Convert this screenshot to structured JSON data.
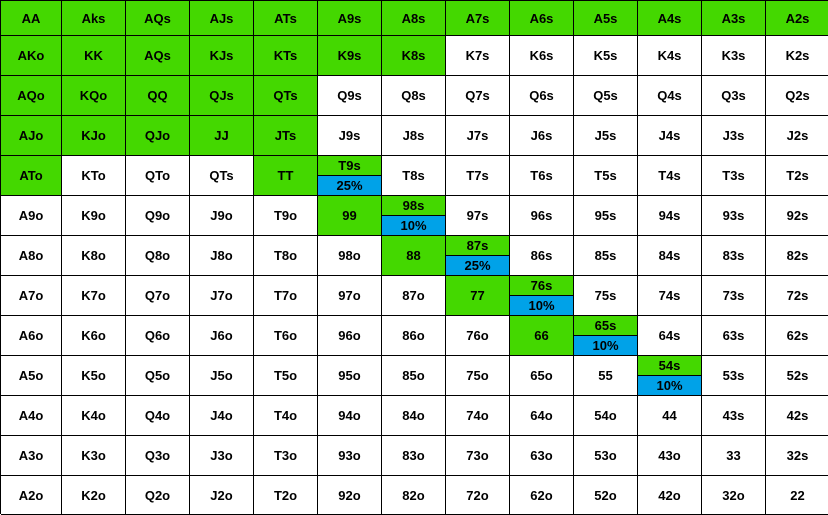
{
  "colors": {
    "raise": "#44d800",
    "mixed": "#00a2e8",
    "fold": "#ffffff"
  },
  "rows": [
    [
      {
        "h": "AA",
        "a": "full"
      },
      {
        "h": "Aks",
        "a": "full"
      },
      {
        "h": "AQs",
        "a": "full"
      },
      {
        "h": "AJs",
        "a": "full"
      },
      {
        "h": "ATs",
        "a": "full"
      },
      {
        "h": "A9s",
        "a": "full"
      },
      {
        "h": "A8s",
        "a": "full"
      },
      {
        "h": "A7s",
        "a": "full"
      },
      {
        "h": "A6s",
        "a": "full"
      },
      {
        "h": "A5s",
        "a": "full"
      },
      {
        "h": "A4s",
        "a": "full"
      },
      {
        "h": "A3s",
        "a": "full"
      },
      {
        "h": "A2s",
        "a": "full"
      }
    ],
    [
      {
        "h": "AKo",
        "a": "full"
      },
      {
        "h": "KK",
        "a": "full"
      },
      {
        "h": "AQs",
        "a": "full"
      },
      {
        "h": "KJs",
        "a": "full"
      },
      {
        "h": "KTs",
        "a": "full"
      },
      {
        "h": "K9s",
        "a": "full"
      },
      {
        "h": "K8s",
        "a": "full"
      },
      {
        "h": "K7s",
        "a": "none"
      },
      {
        "h": "K6s",
        "a": "none"
      },
      {
        "h": "K5s",
        "a": "none"
      },
      {
        "h": "K4s",
        "a": "none"
      },
      {
        "h": "K3s",
        "a": "none"
      },
      {
        "h": "K2s",
        "a": "none"
      }
    ],
    [
      {
        "h": "AQo",
        "a": "full"
      },
      {
        "h": "KQo",
        "a": "full"
      },
      {
        "h": "QQ",
        "a": "full"
      },
      {
        "h": "QJs",
        "a": "full"
      },
      {
        "h": "QTs",
        "a": "full"
      },
      {
        "h": "Q9s",
        "a": "none"
      },
      {
        "h": "Q8s",
        "a": "none"
      },
      {
        "h": "Q7s",
        "a": "none"
      },
      {
        "h": "Q6s",
        "a": "none"
      },
      {
        "h": "Q5s",
        "a": "none"
      },
      {
        "h": "Q4s",
        "a": "none"
      },
      {
        "h": "Q3s",
        "a": "none"
      },
      {
        "h": "Q2s",
        "a": "none"
      }
    ],
    [
      {
        "h": "AJo",
        "a": "full"
      },
      {
        "h": "KJo",
        "a": "full"
      },
      {
        "h": "QJo",
        "a": "full"
      },
      {
        "h": "JJ",
        "a": "full"
      },
      {
        "h": "JTs",
        "a": "full"
      },
      {
        "h": "J9s",
        "a": "none"
      },
      {
        "h": "J8s",
        "a": "none"
      },
      {
        "h": "J7s",
        "a": "none"
      },
      {
        "h": "J6s",
        "a": "none"
      },
      {
        "h": "J5s",
        "a": "none"
      },
      {
        "h": "J4s",
        "a": "none"
      },
      {
        "h": "J3s",
        "a": "none"
      },
      {
        "h": "J2s",
        "a": "none"
      }
    ],
    [
      {
        "h": "ATo",
        "a": "full"
      },
      {
        "h": "KTo",
        "a": "none"
      },
      {
        "h": "QTo",
        "a": "none"
      },
      {
        "h": "QTs",
        "a": "none"
      },
      {
        "h": "TT",
        "a": "full"
      },
      {
        "h": "T9s",
        "a": "split",
        "p": "25%"
      },
      {
        "h": "T8s",
        "a": "none"
      },
      {
        "h": "T7s",
        "a": "none"
      },
      {
        "h": "T6s",
        "a": "none"
      },
      {
        "h": "T5s",
        "a": "none"
      },
      {
        "h": "T4s",
        "a": "none"
      },
      {
        "h": "T3s",
        "a": "none"
      },
      {
        "h": "T2s",
        "a": "none"
      }
    ],
    [
      {
        "h": "A9o",
        "a": "none"
      },
      {
        "h": "K9o",
        "a": "none"
      },
      {
        "h": "Q9o",
        "a": "none"
      },
      {
        "h": "J9o",
        "a": "none"
      },
      {
        "h": "T9o",
        "a": "none"
      },
      {
        "h": "99",
        "a": "full"
      },
      {
        "h": "98s",
        "a": "split",
        "p": "10%"
      },
      {
        "h": "97s",
        "a": "none"
      },
      {
        "h": "96s",
        "a": "none"
      },
      {
        "h": "95s",
        "a": "none"
      },
      {
        "h": "94s",
        "a": "none"
      },
      {
        "h": "93s",
        "a": "none"
      },
      {
        "h": "92s",
        "a": "none"
      }
    ],
    [
      {
        "h": "A8o",
        "a": "none"
      },
      {
        "h": "K8o",
        "a": "none"
      },
      {
        "h": "Q8o",
        "a": "none"
      },
      {
        "h": "J8o",
        "a": "none"
      },
      {
        "h": "T8o",
        "a": "none"
      },
      {
        "h": "98o",
        "a": "none"
      },
      {
        "h": "88",
        "a": "full"
      },
      {
        "h": "87s",
        "a": "split",
        "p": "25%"
      },
      {
        "h": "86s",
        "a": "none"
      },
      {
        "h": "85s",
        "a": "none"
      },
      {
        "h": "84s",
        "a": "none"
      },
      {
        "h": "83s",
        "a": "none"
      },
      {
        "h": "82s",
        "a": "none"
      }
    ],
    [
      {
        "h": "A7o",
        "a": "none"
      },
      {
        "h": "K7o",
        "a": "none"
      },
      {
        "h": "Q7o",
        "a": "none"
      },
      {
        "h": "J7o",
        "a": "none"
      },
      {
        "h": "T7o",
        "a": "none"
      },
      {
        "h": "97o",
        "a": "none"
      },
      {
        "h": "87o",
        "a": "none"
      },
      {
        "h": "77",
        "a": "full"
      },
      {
        "h": "76s",
        "a": "split",
        "p": "10%"
      },
      {
        "h": "75s",
        "a": "none"
      },
      {
        "h": "74s",
        "a": "none"
      },
      {
        "h": "73s",
        "a": "none"
      },
      {
        "h": "72s",
        "a": "none"
      }
    ],
    [
      {
        "h": "A6o",
        "a": "none"
      },
      {
        "h": "K6o",
        "a": "none"
      },
      {
        "h": "Q6o",
        "a": "none"
      },
      {
        "h": "J6o",
        "a": "none"
      },
      {
        "h": "T6o",
        "a": "none"
      },
      {
        "h": "96o",
        "a": "none"
      },
      {
        "h": "86o",
        "a": "none"
      },
      {
        "h": "76o",
        "a": "none"
      },
      {
        "h": "66",
        "a": "full"
      },
      {
        "h": "65s",
        "a": "split",
        "p": "10%"
      },
      {
        "h": "64s",
        "a": "none"
      },
      {
        "h": "63s",
        "a": "none"
      },
      {
        "h": "62s",
        "a": "none"
      }
    ],
    [
      {
        "h": "A5o",
        "a": "none"
      },
      {
        "h": "K5o",
        "a": "none"
      },
      {
        "h": "Q5o",
        "a": "none"
      },
      {
        "h": "J5o",
        "a": "none"
      },
      {
        "h": "T5o",
        "a": "none"
      },
      {
        "h": "95o",
        "a": "none"
      },
      {
        "h": "85o",
        "a": "none"
      },
      {
        "h": "75o",
        "a": "none"
      },
      {
        "h": "65o",
        "a": "none"
      },
      {
        "h": "55",
        "a": "none"
      },
      {
        "h": "54s",
        "a": "split",
        "p": "10%"
      },
      {
        "h": "53s",
        "a": "none"
      },
      {
        "h": "52s",
        "a": "none"
      }
    ],
    [
      {
        "h": "A4o",
        "a": "none"
      },
      {
        "h": "K4o",
        "a": "none"
      },
      {
        "h": "Q4o",
        "a": "none"
      },
      {
        "h": "J4o",
        "a": "none"
      },
      {
        "h": "T4o",
        "a": "none"
      },
      {
        "h": "94o",
        "a": "none"
      },
      {
        "h": "84o",
        "a": "none"
      },
      {
        "h": "74o",
        "a": "none"
      },
      {
        "h": "64o",
        "a": "none"
      },
      {
        "h": "54o",
        "a": "none"
      },
      {
        "h": "44",
        "a": "none"
      },
      {
        "h": "43s",
        "a": "none"
      },
      {
        "h": "42s",
        "a": "none"
      }
    ],
    [
      {
        "h": "A3o",
        "a": "none"
      },
      {
        "h": "K3o",
        "a": "none"
      },
      {
        "h": "Q3o",
        "a": "none"
      },
      {
        "h": "J3o",
        "a": "none"
      },
      {
        "h": "T3o",
        "a": "none"
      },
      {
        "h": "93o",
        "a": "none"
      },
      {
        "h": "83o",
        "a": "none"
      },
      {
        "h": "73o",
        "a": "none"
      },
      {
        "h": "63o",
        "a": "none"
      },
      {
        "h": "53o",
        "a": "none"
      },
      {
        "h": "43o",
        "a": "none"
      },
      {
        "h": "33",
        "a": "none"
      },
      {
        "h": "32s",
        "a": "none"
      }
    ],
    [
      {
        "h": "A2o",
        "a": "none"
      },
      {
        "h": "K2o",
        "a": "none"
      },
      {
        "h": "Q2o",
        "a": "none"
      },
      {
        "h": "J2o",
        "a": "none"
      },
      {
        "h": "T2o",
        "a": "none"
      },
      {
        "h": "92o",
        "a": "none"
      },
      {
        "h": "82o",
        "a": "none"
      },
      {
        "h": "72o",
        "a": "none"
      },
      {
        "h": "62o",
        "a": "none"
      },
      {
        "h": "52o",
        "a": "none"
      },
      {
        "h": "42o",
        "a": "none"
      },
      {
        "h": "32o",
        "a": "none"
      },
      {
        "h": "22",
        "a": "none"
      }
    ]
  ]
}
